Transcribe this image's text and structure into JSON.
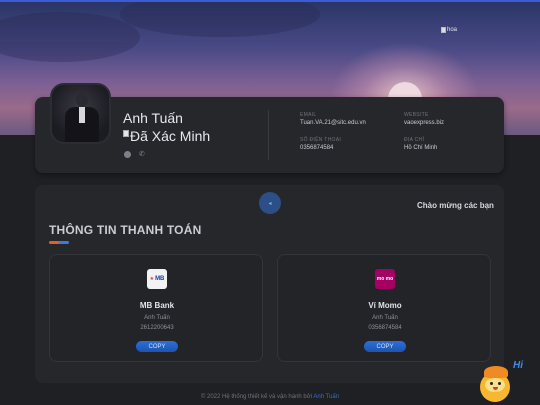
{
  "hero": {
    "image_alt": "hoa"
  },
  "profile": {
    "name": "Anh Tuấn",
    "verified_alt": "Đã Xác Minh",
    "email_label": "EMAIL",
    "email": "Tuan.VA.21@sitc.edu.vn",
    "website_label": "WEBSITE",
    "website": "vaoexpress.biz",
    "phone_label": "SỐ ĐIỆN THOẠI",
    "phone": "0356874584",
    "address_label": "ĐỊA CHỈ",
    "address": "Hồ Chí Minh"
  },
  "main": {
    "welcome": "Chào mừng các bạn",
    "section_title": "THÔNG TIN THANH TOÁN",
    "center_icon": "arrow-icon"
  },
  "payments": [
    {
      "logo_text": "MB",
      "bank": "MB Bank",
      "holder": "Anh Tuấn",
      "account": "2612200643",
      "copy_label": "COPY"
    },
    {
      "logo_text": "mo mo",
      "bank": "Ví Momo",
      "holder": "Anh Tuấn",
      "account": "0356874584",
      "copy_label": "COPY"
    }
  ],
  "footer": {
    "text": "© 2022 Hệ thống thiết kế và vận hành bởi",
    "author": "Anh Tuấn"
  },
  "mascot": {
    "greeting": "Hi"
  },
  "colors": {
    "accent": "#2c6fd8",
    "card_bg": "#26272b",
    "page_bg": "#1f2023",
    "momo": "#a50064"
  }
}
